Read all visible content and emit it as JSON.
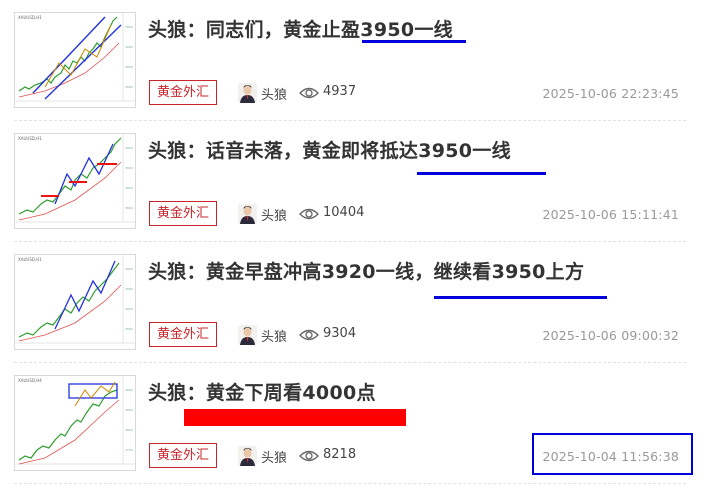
{
  "articles": [
    {
      "title": "头狼：同志们，黄金止盈3950一线",
      "category": "黄金外汇",
      "author": "头狼",
      "views": "4937",
      "time": "2025-10-06 22:23:45"
    },
    {
      "title": "头狼：话音未落，黄金即将抵达3950一线",
      "category": "黄金外汇",
      "author": "头狼",
      "views": "10404",
      "time": "2025-10-06 15:11:41"
    },
    {
      "title": "头狼：黄金早盘冲高3920一线，继续看3950上方",
      "category": "黄金外汇",
      "author": "头狼",
      "views": "9304",
      "time": "2025-10-06 09:00:32"
    },
    {
      "title": "头狼：黄金下周看4000点",
      "category": "黄金外汇",
      "author": "头狼",
      "views": "8218",
      "time": "2025-10-04 11:56:38"
    }
  ],
  "annotation_colors": {
    "blue": "#0000dd",
    "red": "#ff0000"
  },
  "colors": {
    "category": "#c9262b",
    "title": "#333333",
    "meta": "#999999"
  }
}
